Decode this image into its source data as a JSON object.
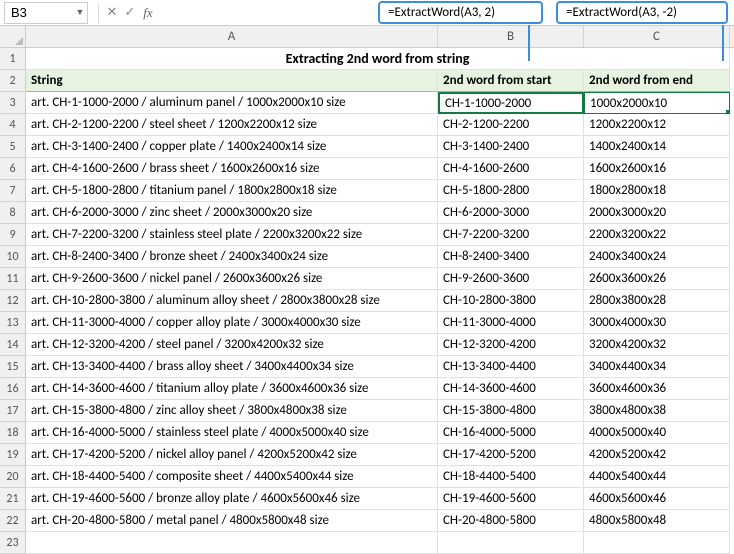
{
  "formula_bar": {
    "cell_ref": "B3",
    "formula": ""
  },
  "callouts": {
    "b": "=ExtractWord(A3, 2)",
    "c": "=ExtractWord(A3, -2)"
  },
  "col_headers": {
    "a": "A",
    "b": "B",
    "c": "C"
  },
  "title": "Extracting 2nd word from string",
  "headers": {
    "a": "String",
    "b": "2nd word from start",
    "c": "2nd word from end"
  },
  "rows": [
    {
      "n": "3",
      "a": "art. CH-1-1000-2000 / aluminum panel / 1000x2000x10 size",
      "b": "CH-1-1000-2000",
      "c": "1000x2000x10"
    },
    {
      "n": "4",
      "a": "art. CH-2-1200-2200 / steel sheet / 1200x2200x12 size",
      "b": "CH-2-1200-2200",
      "c": "1200x2200x12"
    },
    {
      "n": "5",
      "a": "art. CH-3-1400-2400 / copper plate / 1400x2400x14 size",
      "b": "CH-3-1400-2400",
      "c": "1400x2400x14"
    },
    {
      "n": "6",
      "a": "art. CH-4-1600-2600 / brass sheet / 1600x2600x16 size",
      "b": "CH-4-1600-2600",
      "c": "1600x2600x16"
    },
    {
      "n": "7",
      "a": "art. CH-5-1800-2800 / titanium panel / 1800x2800x18 size",
      "b": "CH-5-1800-2800",
      "c": "1800x2800x18"
    },
    {
      "n": "8",
      "a": "art. CH-6-2000-3000 / zinc sheet / 2000x3000x20 size",
      "b": "CH-6-2000-3000",
      "c": "2000x3000x20"
    },
    {
      "n": "9",
      "a": "art. CH-7-2200-3200 / stainless steel plate / 2200x3200x22 size",
      "b": "CH-7-2200-3200",
      "c": "2200x3200x22"
    },
    {
      "n": "10",
      "a": "art. CH-8-2400-3400 / bronze sheet / 2400x3400x24 size",
      "b": "CH-8-2400-3400",
      "c": "2400x3400x24"
    },
    {
      "n": "11",
      "a": "art. CH-9-2600-3600 / nickel panel / 2600x3600x26 size",
      "b": "CH-9-2600-3600",
      "c": "2600x3600x26"
    },
    {
      "n": "12",
      "a": "art. CH-10-2800-3800 / aluminum alloy sheet / 2800x3800x28 size",
      "b": "CH-10-2800-3800",
      "c": "2800x3800x28"
    },
    {
      "n": "13",
      "a": "art. CH-11-3000-4000 / copper alloy plate / 3000x4000x30 size",
      "b": "CH-11-3000-4000",
      "c": "3000x4000x30"
    },
    {
      "n": "14",
      "a": "art. CH-12-3200-4200 / steel panel / 3200x4200x32 size",
      "b": "CH-12-3200-4200",
      "c": "3200x4200x32"
    },
    {
      "n": "15",
      "a": "art. CH-13-3400-4400 / brass alloy sheet / 3400x4400x34 size",
      "b": "CH-13-3400-4400",
      "c": "3400x4400x34"
    },
    {
      "n": "16",
      "a": "art. CH-14-3600-4600 / titanium alloy plate / 3600x4600x36 size",
      "b": "CH-14-3600-4600",
      "c": "3600x4600x36"
    },
    {
      "n": "17",
      "a": "art. CH-15-3800-4800 / zinc alloy sheet / 3800x4800x38 size",
      "b": "CH-15-3800-4800",
      "c": "3800x4800x38"
    },
    {
      "n": "18",
      "a": "art. CH-16-4000-5000 / stainless steel plate / 4000x5000x40 size",
      "b": "CH-16-4000-5000",
      "c": "4000x5000x40"
    },
    {
      "n": "19",
      "a": "art. CH-17-4200-5200 / nickel alloy panel / 4200x5200x42 size",
      "b": "CH-17-4200-5200",
      "c": "4200x5200x42"
    },
    {
      "n": "20",
      "a": "art. CH-18-4400-5400 / composite sheet / 4400x5400x44 size",
      "b": "CH-18-4400-5400",
      "c": "4400x5400x44"
    },
    {
      "n": "21",
      "a": "art. CH-19-4600-5600 / bronze alloy plate / 4600x5600x46 size",
      "b": "CH-19-4600-5600",
      "c": "4600x5600x46"
    },
    {
      "n": "22",
      "a": "art. CH-20-4800-5800 / metal panel / 4800x5800x48 size",
      "b": "CH-20-4800-5800",
      "c": "4800x5800x48"
    }
  ],
  "empty_rows": [
    "1",
    "2",
    "23"
  ]
}
